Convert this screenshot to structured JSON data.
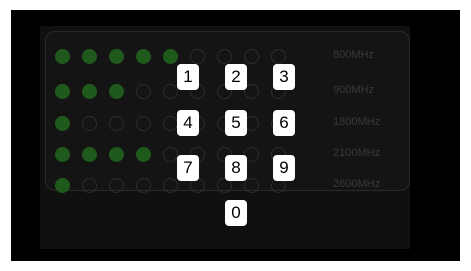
{
  "signal_panel": {
    "rows": [
      {
        "band": "800MHz",
        "dots": [
          1,
          1,
          1,
          1,
          1,
          0,
          0,
          0,
          0
        ]
      },
      {
        "band": "900MHz",
        "dots": [
          1,
          1,
          1,
          0,
          0,
          0,
          0,
          0,
          0
        ]
      },
      {
        "band": "1800MHz",
        "dots": [
          1,
          0,
          0,
          0,
          0,
          0,
          0,
          0,
          0
        ]
      },
      {
        "band": "2100MHz",
        "dots": [
          1,
          1,
          1,
          1,
          0,
          0,
          0,
          0,
          0
        ]
      },
      {
        "band": "2600MHz",
        "dots": [
          1,
          0,
          0,
          0,
          0,
          0,
          0,
          0,
          0
        ]
      }
    ]
  },
  "keypad": {
    "keys": [
      "1",
      "2",
      "3",
      "4",
      "5",
      "6",
      "7",
      "8",
      "9",
      "0"
    ]
  },
  "colors": {
    "screen_bg": "#000000",
    "dot_on": "#1f5a1c",
    "key_bg": "#ffffff"
  }
}
